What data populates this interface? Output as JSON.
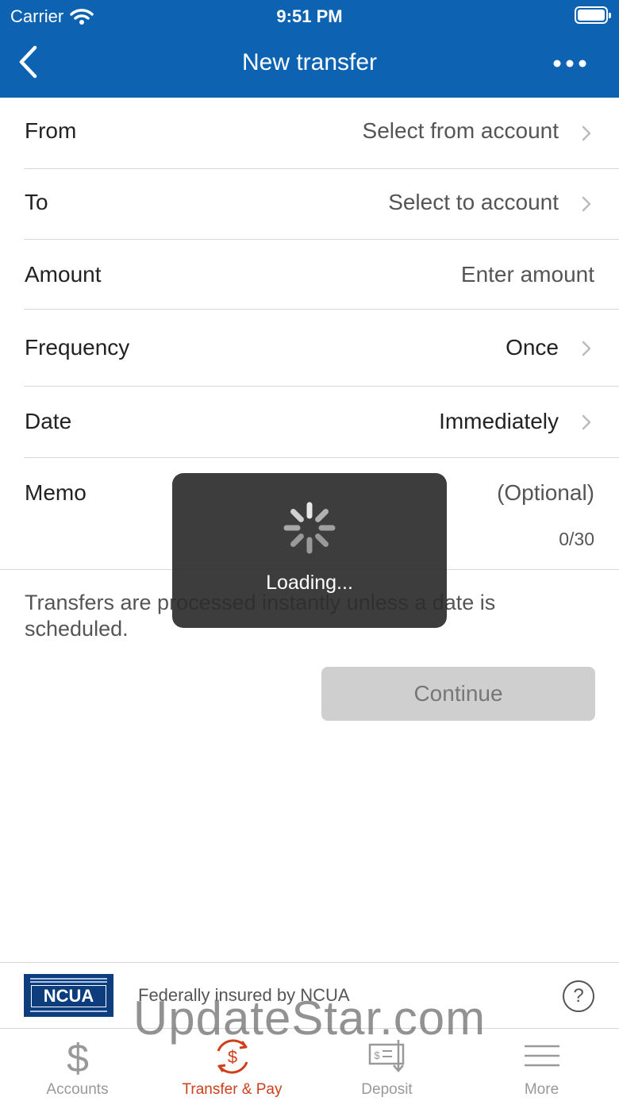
{
  "status_bar": {
    "carrier": "Carrier",
    "time": "9:51 PM"
  },
  "header": {
    "title": "New transfer"
  },
  "form": {
    "from": {
      "label": "From",
      "value": "Select from account"
    },
    "to": {
      "label": "To",
      "value": "Select to account"
    },
    "amount": {
      "label": "Amount",
      "placeholder": "Enter amount"
    },
    "frequency": {
      "label": "Frequency",
      "value": "Once"
    },
    "date": {
      "label": "Date",
      "value": "Immediately"
    },
    "memo": {
      "label": "Memo",
      "placeholder": "(Optional)",
      "counter": "0/30"
    }
  },
  "info_text": "Transfers are processed instantly unless a date is scheduled.",
  "continue_label": "Continue",
  "loading": {
    "label": "Loading..."
  },
  "ncua": {
    "logo_text": "NCUA",
    "text": "Federally insured by NCUA",
    "help": "?"
  },
  "tabs": [
    {
      "label": "Accounts",
      "icon": "dollar-icon",
      "active": false
    },
    {
      "label": "Transfer & Pay",
      "icon": "transfer-pay-icon",
      "active": true
    },
    {
      "label": "Deposit",
      "icon": "deposit-check-icon",
      "active": false
    },
    {
      "label": "More",
      "icon": "hamburger-icon",
      "active": false
    }
  ],
  "watermark": "UpdateStar.com",
  "colors": {
    "brand": "#0d63b2",
    "active_tab": "#cf3f1c",
    "disabled_button": "#cfcfcf"
  }
}
